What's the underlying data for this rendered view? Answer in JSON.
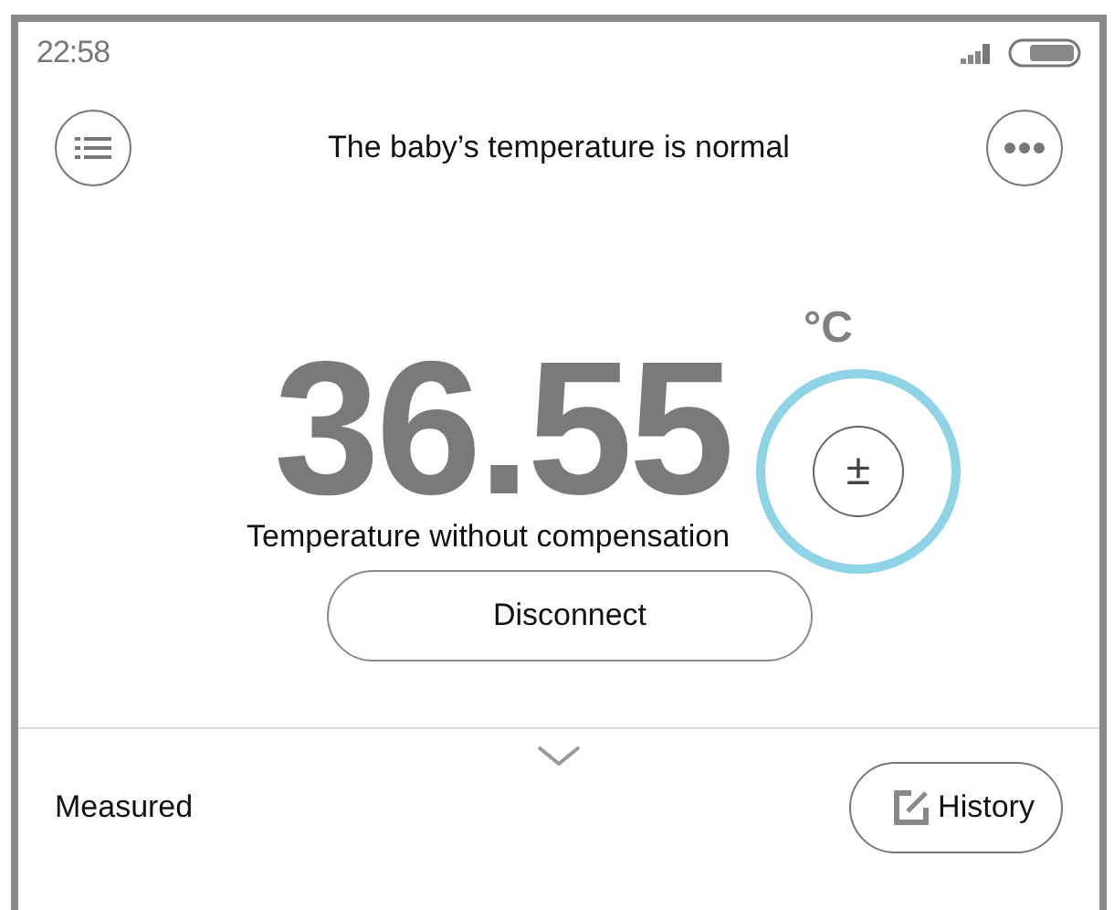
{
  "status_bar": {
    "time": "22:58"
  },
  "header": {
    "title": "The baby’s temperature is normal"
  },
  "reading": {
    "value": "36.55",
    "unit": "°C",
    "caption": "Temperature without compensation",
    "compensation_button": "±"
  },
  "buttons": [
    "Disconnect"
  ],
  "footer": {
    "label": "Measured",
    "history_button": "History"
  }
}
